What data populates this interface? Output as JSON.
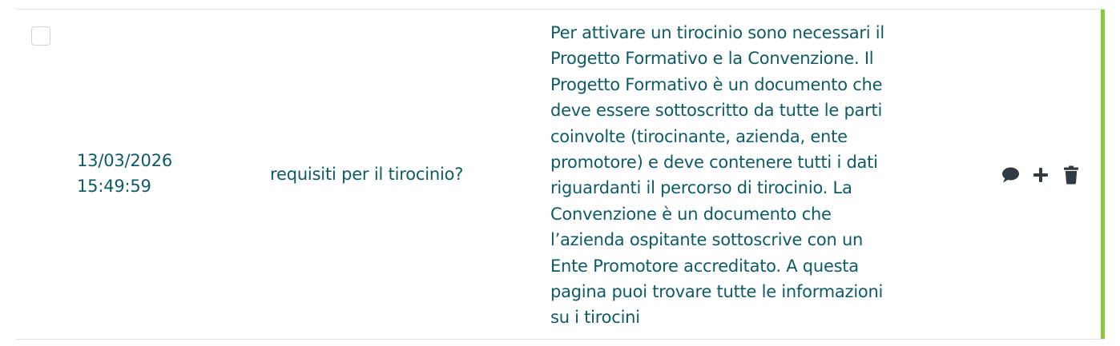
{
  "row": {
    "checked": false,
    "date": "13/03/2026",
    "time": "15:49:59",
    "question": "requisiti per il tirocinio?",
    "answer": "Per attivare un tirocinio sono necessari il Progetto Formativo e la Convenzione. Il Progetto Formativo è un documento che deve essere sottoscritto da tutte le parti coinvolte (tirocinante, azienda, ente promotore) e deve contenere tutti i dati riguardanti il percorso di tirocinio. La Convenzione è un documento che l’azienda ospitante sottoscrive con un Ente Promotore accreditato. A questa pagina puoi trovare tutte le informazioni su i tirocini"
  },
  "actions": [
    {
      "icon": "comment-icon"
    },
    {
      "icon": "plus-icon"
    },
    {
      "icon": "trash-icon"
    }
  ],
  "colors": {
    "text": "#0d5b63",
    "accent": "#8cc63f",
    "icon": "#2f3b40"
  }
}
